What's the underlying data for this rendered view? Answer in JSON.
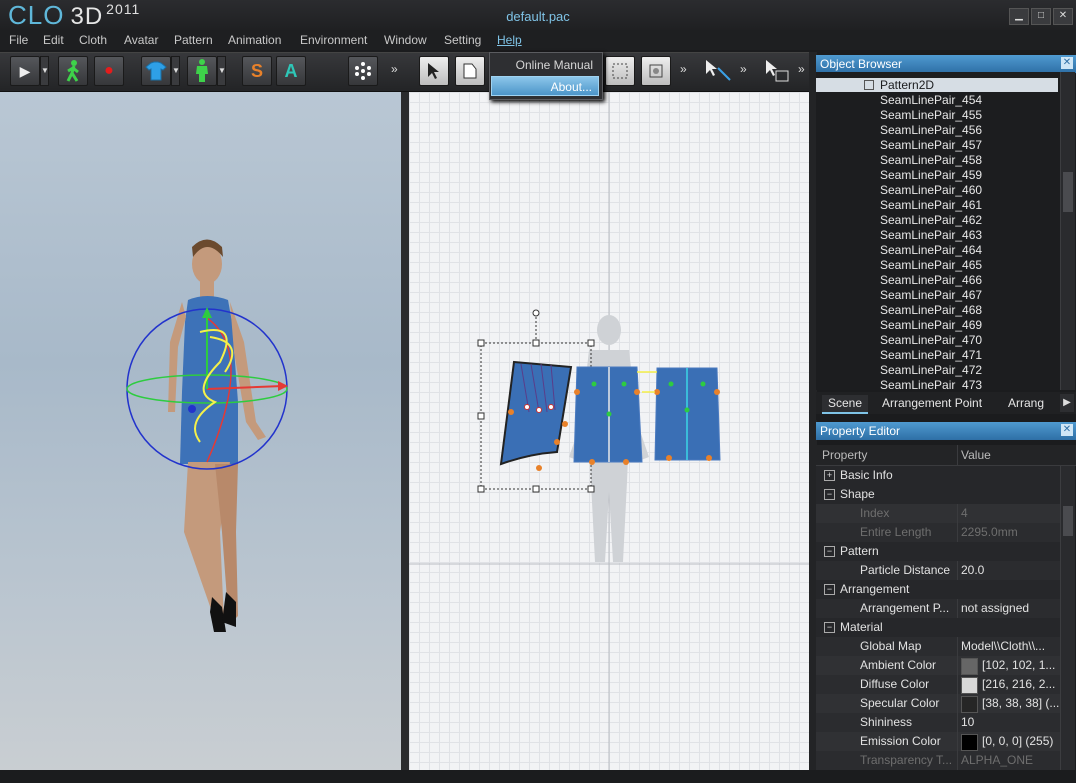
{
  "window": {
    "logo_text": "CLO",
    "logo_product": "3D",
    "logo_year": "2011",
    "document_title": "default.pac",
    "controls": [
      "▁",
      "□",
      "✕"
    ]
  },
  "menu": [
    "File",
    "Edit",
    "Cloth",
    "Avatar",
    "Pattern",
    "Animation",
    "Environment",
    "Window",
    "Setting",
    "Help"
  ],
  "help_menu": {
    "items": [
      "Online Manual",
      "About..."
    ],
    "highlighted": "About..."
  },
  "toolbar": {
    "play": "▶",
    "dropdown": "▼",
    "record": "●",
    "shirt": "👕",
    "avatar": "🚶",
    "s_label": "S",
    "a_label": "A",
    "more": "»"
  },
  "object_browser": {
    "title": "Object Browser",
    "close": "✕",
    "root": "Pattern2D",
    "items": [
      "SeamLinePair_454",
      "SeamLinePair_455",
      "SeamLinePair_456",
      "SeamLinePair_457",
      "SeamLinePair_458",
      "SeamLinePair_459",
      "SeamLinePair_460",
      "SeamLinePair_461",
      "SeamLinePair_462",
      "SeamLinePair_463",
      "SeamLinePair_464",
      "SeamLinePair_465",
      "SeamLinePair_466",
      "SeamLinePair_467",
      "SeamLinePair_468",
      "SeamLinePair_469",
      "SeamLinePair_470",
      "SeamLinePair_471",
      "SeamLinePair_472",
      "SeamLinePair_473"
    ],
    "tabs": [
      "Scene",
      "Arrangement Point",
      "Arrang"
    ]
  },
  "property_editor": {
    "title": "Property Editor",
    "close": "✕",
    "columns": [
      "Property",
      "Value"
    ],
    "rows": [
      {
        "type": "cat",
        "label": "Basic Info",
        "expander": "+"
      },
      {
        "type": "cat",
        "label": "Shape",
        "expander": "−"
      },
      {
        "type": "prop",
        "label": "Index",
        "value": "4",
        "disabled": true
      },
      {
        "type": "prop",
        "label": "Entire Length",
        "value": "2295.0mm",
        "disabled": true
      },
      {
        "type": "cat",
        "label": "Pattern",
        "expander": "−"
      },
      {
        "type": "prop",
        "label": "Particle Distance",
        "value": "20.0"
      },
      {
        "type": "cat",
        "label": "Arrangement",
        "expander": "−"
      },
      {
        "type": "prop",
        "label": "Arrangement P...",
        "value": "not assigned"
      },
      {
        "type": "cat",
        "label": "Material",
        "expander": "−"
      },
      {
        "type": "prop",
        "label": "Global Map",
        "value": "Model\\\\Cloth\\\\..."
      },
      {
        "type": "color",
        "label": "Ambient Color",
        "value": "[102, 102, 1...",
        "swatch": "#666666"
      },
      {
        "type": "color",
        "label": "Diffuse Color",
        "value": "[216, 216, 2...",
        "swatch": "#d8d8d8"
      },
      {
        "type": "color",
        "label": "Specular Color",
        "value": "[38, 38, 38] (...",
        "swatch": "#262626"
      },
      {
        "type": "prop",
        "label": "Shininess",
        "value": "10"
      },
      {
        "type": "color",
        "label": "Emission Color",
        "value": "[0, 0, 0] (255)",
        "swatch": "#000000"
      },
      {
        "type": "prop",
        "label": "Transparency T...",
        "value": "ALPHA_ONE",
        "disabled": true
      }
    ]
  },
  "colors": {
    "accent": "#4f9ad0",
    "pattern_fill": "#3a6fb5",
    "gizmo_x": "#e53935",
    "gizmo_y": "#2ecc40",
    "gizmo_z": "#2233cc"
  }
}
